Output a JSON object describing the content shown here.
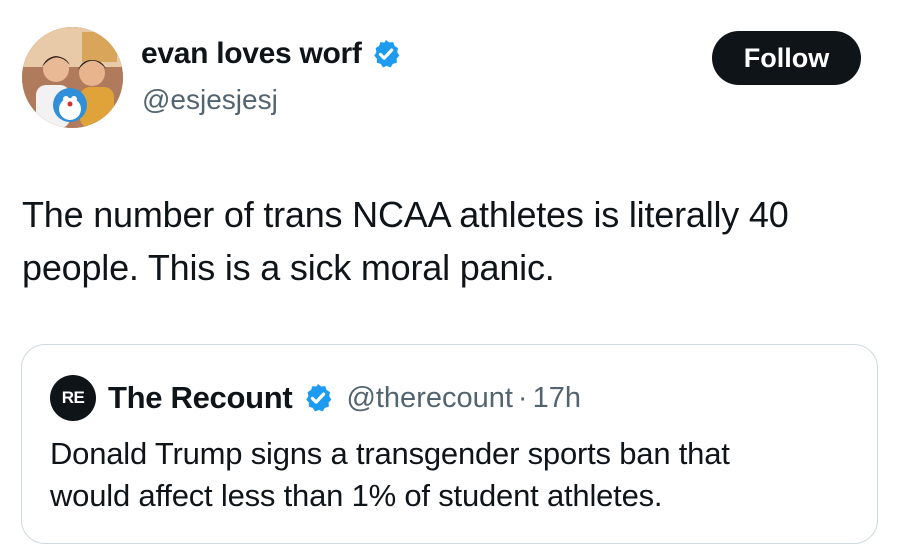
{
  "author": {
    "display_name": "evan loves worf",
    "handle": "@esjesjesj",
    "verified": true,
    "avatar": "avatar-photo"
  },
  "follow_button": {
    "label": "Follow"
  },
  "tweet": {
    "text_line1": "The number of trans NCAA athletes is literally 40",
    "text_line2": "people. This is a sick moral panic."
  },
  "quote": {
    "logo_text": "RE",
    "display_name": "The Recount",
    "handle": "@therecount",
    "separator": "·",
    "time": "17h",
    "verified": true,
    "text_line1": "Donald Trump signs a transgender sports ban that",
    "text_line2": "would affect less than 1% of student athletes."
  },
  "colors": {
    "text_primary": "#0f1419",
    "text_secondary": "#536471",
    "verified_blue": "#1d9bf0",
    "follow_bg": "#0f1419",
    "card_border": "#cfd9de"
  }
}
